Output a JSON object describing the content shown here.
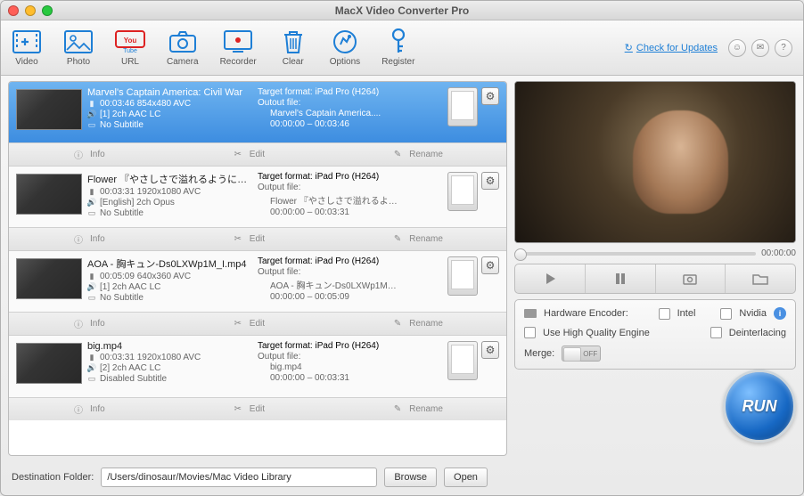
{
  "window": {
    "title": "MacX Video Converter Pro"
  },
  "toolbar": {
    "items": [
      {
        "label": "Video",
        "icon": "video-add-icon"
      },
      {
        "label": "Photo",
        "icon": "photo-icon"
      },
      {
        "label": "URL",
        "icon": "youtube-icon"
      },
      {
        "label": "Camera",
        "icon": "camera-icon"
      },
      {
        "label": "Recorder",
        "icon": "recorder-icon"
      },
      {
        "label": "Clear",
        "icon": "trash-icon"
      },
      {
        "label": "Options",
        "icon": "options-icon"
      },
      {
        "label": "Register",
        "icon": "key-icon"
      }
    ],
    "updates_label": "Check for Updates"
  },
  "queue": [
    {
      "selected": true,
      "title": "Marvel's Captain America: Civil War",
      "duration_res": "00:03:46 854x480 AVC",
      "audio": "[1] 2ch AAC LC",
      "subtitle": "No Subtitle",
      "target": "Target format: iPad Pro (H264)",
      "outlabel": "Outout file:",
      "outfile": "Marvel's Captain America....",
      "range": "00:00:00 – 00:03:46"
    },
    {
      "selected": false,
      "title": "Flower 『やさしさで溢れるように』 [映…",
      "duration_res": "00:03:31 1920x1080 AVC",
      "audio": "[English] 2ch Opus",
      "subtitle": "No Subtitle",
      "target": "Target format: iPad Pro (H264)",
      "outlabel": "Output file:",
      "outfile": "Flower 『やさしさで溢れるよ…",
      "range": "00:00:00 – 00:03:31"
    },
    {
      "selected": false,
      "title": "AOA - 胸キュン-Ds0LXWp1M_I.mp4",
      "duration_res": "00:05:09 640x360 AVC",
      "audio": "[1] 2ch AAC LC",
      "subtitle": "No Subtitle",
      "target": "Target format: iPad Pro (H264)",
      "outlabel": "Output file:",
      "outfile": "AOA - 胸キュン-Ds0LXWp1M…",
      "range": "00:00:00 – 00:05:09"
    },
    {
      "selected": false,
      "title": "big.mp4",
      "duration_res": "00:03:31 1920x1080 AVC",
      "audio": "[2] 2ch AAC LC",
      "subtitle": "Disabled Subtitle",
      "target": "Target format: iPad Pro (H264)",
      "outlabel": "Output file:",
      "outfile": "big.mp4",
      "range": "00:00:00 – 00:03:31"
    }
  ],
  "item_actions": {
    "info": "Info",
    "edit": "Edit",
    "rename": "Rename"
  },
  "preview": {
    "time": "00:00:00"
  },
  "options": {
    "hw_label": "Hardware Encoder:",
    "intel": "Intel",
    "nvidia": "Nvidia",
    "hq": "Use High Quality Engine",
    "deint": "Deinterlacing",
    "merge_label": "Merge:",
    "merge_state": "OFF"
  },
  "run_label": "RUN",
  "footer": {
    "dest_label": "Destination Folder:",
    "dest_path": "/Users/dinosaur/Movies/Mac Video Library",
    "browse": "Browse",
    "open": "Open"
  }
}
